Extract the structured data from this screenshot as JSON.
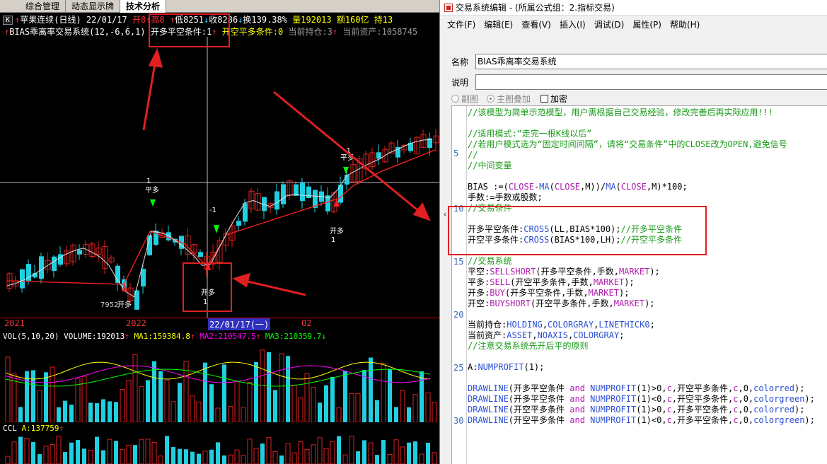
{
  "left_panel": {
    "tabs": [
      "综合管理",
      "动态显示牌",
      "技术分析"
    ],
    "active_tab": "技术分析",
    "quote": {
      "stock_name": "苹果连续(日线)",
      "date": "22/01/17",
      "open": "开8",
      "high": "高8",
      "low": "低8251",
      "close": "收8286",
      "turnover": "换139.38%",
      "volume": "量192013",
      "amount": "额160亿",
      "hold": "持13"
    },
    "formula_line": {
      "name": "BIAS乖离率交易系统(12,-6,6,1)",
      "cond1": "开多平空条件:1",
      "cond2": "开空平多条件:0",
      "holding": "当前持仓:3",
      "assets": "当前资产:1058745"
    },
    "chart_labels": {
      "low_price": "7952",
      "open_long_1": "开多",
      "open_long_2": "开多",
      "open_long_3": "开多",
      "close_long_1": "平多",
      "close_long_2": "平多",
      "num_1": "1",
      "num_neg1_a": "-1",
      "num_neg1_b": "-1",
      "num_1b": "1",
      "num_1c": "1"
    },
    "date_bar": {
      "y2021": "2021",
      "y2022": "2022",
      "cursor_date": "22/01/17(一)",
      "month": "02"
    },
    "volume_indicator": {
      "label": "VOL(5,10,20)",
      "volume": "VOLUME:192013",
      "ma1": "MA1:159384.8",
      "ma2": "MA2:210547.5",
      "ma3": "MA3:210359.7"
    },
    "ccl_indicator": {
      "label": "CCL",
      "a_value": "A:137759"
    }
  },
  "editor": {
    "title": "交易系统编辑 - (所属公式组：2.指标交易)",
    "menus": [
      "文件(F)",
      "编辑(E)",
      "查看(V)",
      "插入(I)",
      "调试(D)",
      "属性(P)",
      "帮助(H)"
    ],
    "name_label": "名称",
    "name_value": "BIAS乖离率交易系统",
    "desc_label": "说明",
    "desc_value": "",
    "option_sub": "副图",
    "option_main": "主图叠加",
    "option_encrypt": "加密",
    "line_numbers": [
      "5",
      "10",
      "15",
      "20",
      "25",
      "30"
    ],
    "code": {
      "l1": "//该模型为简单示范模型，用户需根据自己交易经验，修改完善后再实际应用!!!",
      "l3": "//适用模式:“走完一根K线以后”",
      "l4": "//若用户模式选为“固定时间间隔”，请将“交易条件”中的CLOSE改为OPEN,避免信号",
      "l5": "//",
      "l6": "//中间变量",
      "l8a": "BIAS :=(",
      "l8b": "CLOSE",
      "l8c": "-",
      "l8d": "MA",
      "l8e": "(",
      "l8f": "CLOSE",
      "l8g": ",M))/",
      "l8h": "MA",
      "l8i": "(",
      "l8j": "CLOSE",
      "l8k": ",M)*100;",
      "l9": "手数:=手数或股数;",
      "l10": "//交易条件",
      "l12a": "开多平空条件:",
      "l12b": "CROSS",
      "l12c": "(LL,BIAS*100);",
      "l12d": "//开多平空条件",
      "l13a": "开空平多条件:",
      "l13b": "CROSS",
      "l13c": "(BIAS*100,LH);",
      "l13d": "//开空平多条件",
      "l15": "//交易系统",
      "l16a": "平空:",
      "l16b": "SELLSHORT",
      "l16c": "(开多平空条件,手数,",
      "l16d": "MARKET",
      "l16e": ");",
      "l17a": "平多:",
      "l17b": "SELL",
      "l17c": "(开空平多条件,手数,",
      "l17d": "MARKET",
      "l17e": ");",
      "l18a": "开多:",
      "l18b": "BUY",
      "l18c": "(开多平空条件,手数,",
      "l18d": "MARKET",
      "l18e": ");",
      "l19a": "开空:",
      "l19b": "BUYSHORT",
      "l19c": "(开空平多条件,手数,",
      "l19d": "MARKET",
      "l19e": ");",
      "l21a": "当前持仓:",
      "l21b": "HOLDING",
      "l21c": ",",
      "l21d": "COLORGRAY",
      "l21e": ",",
      "l21f": "LINETHICK0",
      "l21g": ";",
      "l22a": "当前资产:",
      "l22b": "ASSET",
      "l22c": ",",
      "l22d": "NOAXIS",
      "l22e": ",",
      "l22f": "COLORGRAY",
      "l22g": ";",
      "l23": "//注意交易系统先开后平的原则",
      "l25a": "A:",
      "l25b": "NUMPROFIT",
      "l25c": "(1);",
      "dl1": "DRAWLINE",
      "dl_and": "and",
      "dl_np": "NUMPROFIT",
      "l27b": "(开多平空条件 ",
      "l27d": "(1)>0,",
      "l27e": "c",
      "l27f": ",开空平多条件,",
      "l27g": "c",
      "l27h": ",0,",
      "l27i": "colorred",
      "l27j": ");",
      "l28b": "(开多平空条件 ",
      "l28d": "(1)<0,",
      "l28i": "colorgreen",
      "l29b": "(开空平多条件 ",
      "l29f": ",开多平空条件,",
      "l30b": "(开空平多条件 ",
      "l30f": ",开多平空条件,"
    }
  },
  "colors": {
    "up": "#e02020",
    "down": "#20d0e0",
    "editor_comment": "#1a9a1a",
    "editor_keyword": "#2d4fd6",
    "editor_function": "#b01cb0",
    "highlight": "#e02020"
  },
  "chart_data": {
    "type": "candlestick",
    "note_series": [
      "price"
    ],
    "price_range": [
      7900,
      9500
    ]
  }
}
